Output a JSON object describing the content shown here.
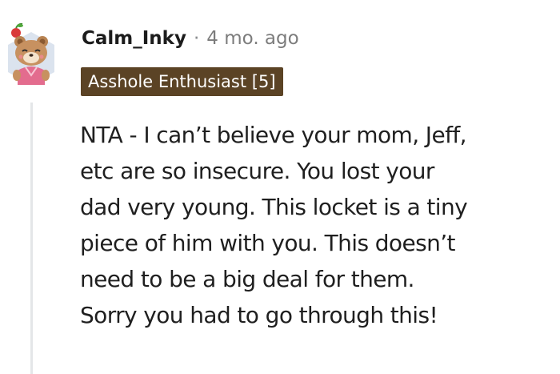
{
  "comment": {
    "username": "Calm_Inky",
    "separator": "·",
    "timestamp": "4 mo. ago",
    "flair": "Asshole Enthusiast [5]",
    "body_lines": [
      "NTA - I can’t believe your mom, Jeff,",
      "etc are so insecure. You lost your",
      "dad very young. This locket is a tiny",
      "piece of him with you. This doesn’t",
      "need to be a big deal for them.",
      "Sorry you had to go through this!"
    ]
  },
  "avatar": {
    "icon": "snoo-bear-avatar-icon"
  },
  "colors": {
    "flair_background": "#5b4325",
    "flair_text": "#ffffff",
    "timestamp": "#7c7c7c",
    "thread_line": "#e4e6e8"
  }
}
